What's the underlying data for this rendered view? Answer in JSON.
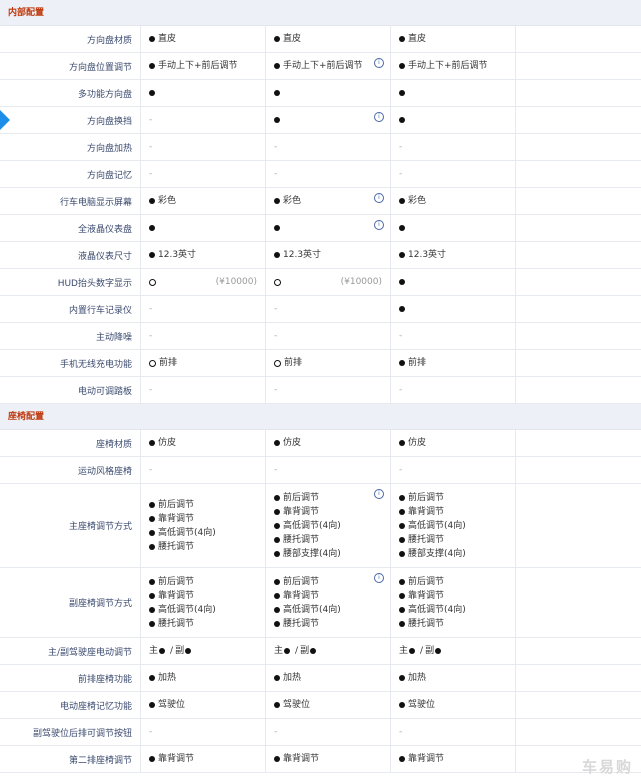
{
  "sections": {
    "interior": "内部配置",
    "seat": "座椅配置"
  },
  "dash": "-",
  "info_icon_glyph": "i",
  "interior_rows": [
    {
      "label": "方向盘材质",
      "cells": [
        "直皮",
        "直皮",
        "直皮",
        ""
      ]
    },
    {
      "label": "方向盘位置调节",
      "cells": [
        "手动上下+前后调节",
        "手动上下+前后调节",
        "手动上下+前后调节",
        ""
      ]
    },
    {
      "label": "多功能方向盘"
    },
    {
      "label": "方向盘换挡"
    },
    {
      "label": "方向盘加热"
    },
    {
      "label": "方向盘记忆"
    },
    {
      "label": "行车电脑显示屏幕",
      "cells": [
        "彩色",
        "彩色",
        "彩色"
      ]
    },
    {
      "label": "全液晶仪表盘"
    },
    {
      "label": "液晶仪表尺寸",
      "cells": [
        "12.3英寸",
        "12.3英寸",
        "12.3英寸"
      ]
    },
    {
      "label": "HUD抬头数字显示",
      "prices": [
        "(¥10000)",
        "(¥10000)"
      ]
    },
    {
      "label": "内置行车记录仪"
    },
    {
      "label": "主动降噪"
    },
    {
      "label": "手机无线充电功能",
      "cells": [
        "前排",
        "前排",
        "前排"
      ]
    },
    {
      "label": "电动可调踏板"
    }
  ],
  "seat_rows": [
    {
      "label": "座椅材质",
      "cells": [
        "仿皮",
        "仿皮",
        "仿皮"
      ]
    },
    {
      "label": "运动风格座椅"
    },
    {
      "label": "主座椅调节方式",
      "lists": [
        [
          "前后调节",
          "靠背调节",
          "高低调节(4向)",
          "腰托调节"
        ],
        [
          "前后调节",
          "靠背调节",
          "高低调节(4向)",
          "腰托调节",
          "腰部支撑(4向)"
        ],
        [
          "前后调节",
          "靠背调节",
          "高低调节(4向)",
          "腰托调节",
          "腰部支撑(4向)"
        ]
      ]
    },
    {
      "label": "副座椅调节方式",
      "lists": [
        [
          "前后调节",
          "靠背调节",
          "高低调节(4向)",
          "腰托调节"
        ],
        [
          "前后调节",
          "靠背调节",
          "高低调节(4向)",
          "腰托调节"
        ],
        [
          "前后调节",
          "靠背调节",
          "高低调节(4向)",
          "腰托调节"
        ]
      ]
    },
    {
      "label": "主/副驾驶座电动调节",
      "main": "主",
      "sub": "副",
      "slash": "/"
    },
    {
      "label": "前排座椅功能",
      "cells": [
        "加热",
        "加热",
        "加热"
      ]
    },
    {
      "label": "电动座椅记忆功能",
      "cells": [
        "驾驶位",
        "驾驶位",
        "驾驶位"
      ]
    },
    {
      "label": "副驾驶位后排可调节按钮"
    },
    {
      "label": "第二排座椅调节",
      "cells": [
        "靠背调节",
        "靠背调节",
        "靠背调节"
      ]
    }
  ],
  "watermark": "车易购"
}
